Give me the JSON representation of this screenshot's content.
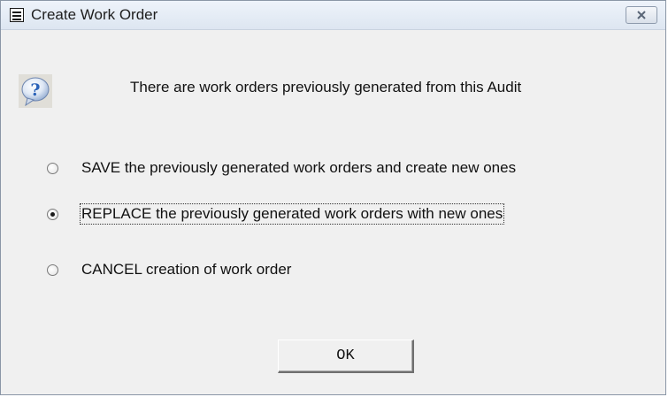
{
  "window": {
    "title": "Create Work Order",
    "icon": "form-icon"
  },
  "dialog": {
    "icon": "question-icon",
    "message": "There are work orders previously generated from this Audit",
    "options": [
      {
        "label": "SAVE the previously generated work orders and create new ones",
        "selected": false
      },
      {
        "label": "REPLACE the previously generated work orders with new ones",
        "selected": true
      },
      {
        "label": "CANCEL creation of work order",
        "selected": false
      }
    ],
    "ok_label": "OK"
  },
  "colors": {
    "dialog_bg": "#f0f0f0",
    "question_icon": "#2a62b8"
  }
}
